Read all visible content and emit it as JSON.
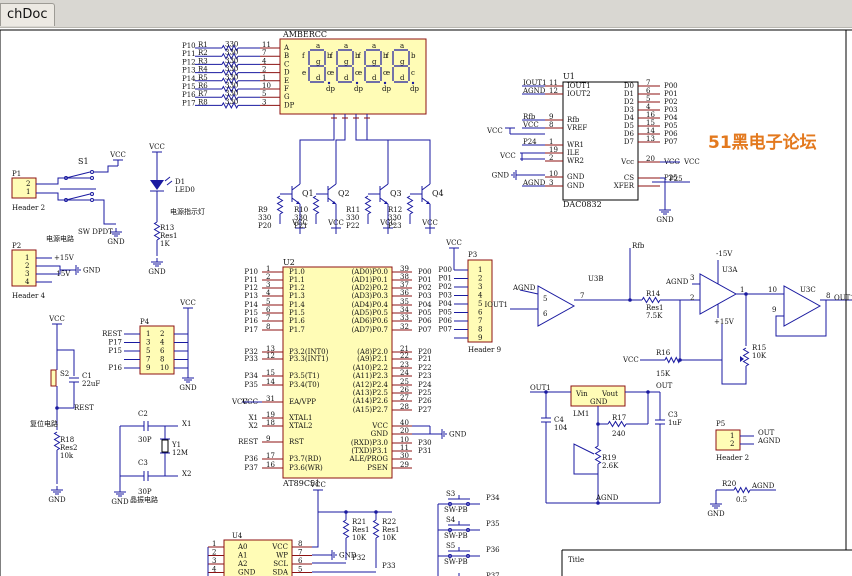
{
  "tab": {
    "label": "chDoc"
  },
  "forum": "51黑电子论坛",
  "display": {
    "ref": "AMBERCC",
    "segments": [
      "A",
      "B",
      "C",
      "D",
      "E",
      "F",
      "G",
      "DP"
    ],
    "seg_pins": [
      "11",
      "7",
      "4",
      "2",
      "1",
      "10",
      "5",
      "3"
    ],
    "nets": [
      "P10",
      "P11",
      "P12",
      "P13",
      "P14",
      "P15",
      "P16",
      "P17"
    ],
    "resistors": [
      "R1",
      "R2",
      "R3",
      "R4",
      "R5",
      "R6",
      "R7",
      "R8"
    ],
    "res_value": "330",
    "digit_labels": [
      "a",
      "b",
      "c",
      "d",
      "e",
      "f",
      "g",
      "dp"
    ]
  },
  "transistors": [
    {
      "ref": "Q1",
      "res": "R9",
      "res_val": "330",
      "net": "P20",
      "vcc": "VCC"
    },
    {
      "ref": "Q2",
      "res": "R10",
      "res_val": "330",
      "net": "P21",
      "vcc": "VCC"
    },
    {
      "ref": "Q3",
      "res": "R11",
      "res_val": "330",
      "net": "P22",
      "vcc": "VCC"
    },
    {
      "ref": "Q4",
      "res": "R12",
      "res_val": "330",
      "net": "P23",
      "vcc": "VCC"
    }
  ],
  "dac": {
    "ref": "U1",
    "part": "DAC0832",
    "left_pins": [
      [
        "IOUT1",
        "11",
        "IOUT1"
      ],
      [
        "AGND",
        "12",
        "IOUT2"
      ],
      [
        "Rfb",
        "9",
        "Rfb"
      ],
      [
        "VCC",
        "8",
        "VREF"
      ],
      [
        "P24",
        "1",
        "WR1"
      ],
      [
        "",
        "19",
        "ILE"
      ],
      [
        "",
        "2",
        "WR2"
      ],
      [
        "",
        "10",
        "GND"
      ],
      [
        "AGND",
        "3",
        "GND"
      ]
    ],
    "right_pins": [
      [
        "D0",
        "7",
        "P00"
      ],
      [
        "D1",
        "6",
        "P01"
      ],
      [
        "D2",
        "5",
        "P02"
      ],
      [
        "D3",
        "4",
        "P03"
      ],
      [
        "D4",
        "16",
        "P04"
      ],
      [
        "D5",
        "15",
        "P05"
      ],
      [
        "D6",
        "14",
        "P06"
      ],
      [
        "D7",
        "13",
        "P07"
      ],
      [
        "Vcc",
        "20",
        "VCC"
      ],
      [
        "CS",
        "",
        "P25"
      ],
      [
        "XFER",
        "",
        ""
      ]
    ],
    "gnd": "GND",
    "vcc": "VCC"
  },
  "header2": {
    "ref": "P1",
    "pins": [
      "2",
      "1"
    ],
    "name": "Header 2"
  },
  "switch": {
    "ref": "S1",
    "name": "SW DPDT",
    "label": "电源电路",
    "vcc": "VCC",
    "gnd": "GND"
  },
  "led": {
    "ref": "D1",
    "name": "LED0",
    "label": "电源指示灯",
    "res": "R13",
    "res_val": "Res1",
    "res_val2": "1K",
    "vcc": "VCC",
    "gnd": "GND"
  },
  "header4": {
    "ref": "P2",
    "pins": [
      "1",
      "2",
      "3",
      "4"
    ],
    "name": "Header 4",
    "nets": [
      "+15V",
      "",
      "-15V",
      ""
    ],
    "gnd": "GND"
  },
  "reset_circuit": {
    "sw": "S2",
    "cap": "C1",
    "cap_val": "22uF",
    "res": "R18",
    "res_val": "Res2",
    "res_val2": "10k",
    "net": "REST",
    "label": "复位电路",
    "vcc": "VCC",
    "gnd": "GND"
  },
  "p4": {
    "ref": "P4",
    "nets": [
      "REST",
      "P17",
      "P15",
      "",
      "P16"
    ],
    "pins": [
      [
        "1",
        "2"
      ],
      [
        "3",
        "4"
      ],
      [
        "5",
        "6"
      ],
      [
        "7",
        "8"
      ],
      [
        "9",
        "10"
      ]
    ],
    "vcc": "VCC",
    "gnd": "GND"
  },
  "crystal": {
    "c2": "C2",
    "c2v": "30P",
    "c3": "C3",
    "c3v": "30P",
    "y": "Y1",
    "yv": "12M",
    "x1": "X1",
    "x2": "X2",
    "label": "晶振电路",
    "gnd": "GND"
  },
  "mcu": {
    "ref": "U2",
    "part": "AT89C51",
    "left": [
      [
        "P10",
        "1",
        "P1.0"
      ],
      [
        "P11",
        "2",
        "P1.1"
      ],
      [
        "P12",
        "3",
        "P1.2"
      ],
      [
        "P13",
        "4",
        "P1.3"
      ],
      [
        "P14",
        "5",
        "P1.4"
      ],
      [
        "P15",
        "6",
        "P1.5"
      ],
      [
        "P16",
        "7",
        "P1.6"
      ],
      [
        "P17",
        "8",
        "P1.7"
      ],
      [
        "P32",
        "13",
        "P3.2(INT0)"
      ],
      [
        "P33",
        "12",
        "P3.3(INT1)"
      ],
      [
        "P34",
        "15",
        "P3.5(T1)"
      ],
      [
        "P35",
        "14",
        "P3.4(T0)"
      ],
      [
        "VCC",
        "31",
        "EA/VPP"
      ],
      [
        "X1",
        "19",
        "XTAL1"
      ],
      [
        "X2",
        "18",
        "XTAL2"
      ],
      [
        "REST",
        "9",
        "RST"
      ],
      [
        "P36",
        "17",
        "P3.7(RD)"
      ],
      [
        "P37",
        "16",
        "P3.6(WR)"
      ]
    ],
    "right": [
      [
        "P00",
        "39",
        "(AD0)P0.0"
      ],
      [
        "P01",
        "38",
        "(AD1)P0.1"
      ],
      [
        "P02",
        "37",
        "(AD2)P0.2"
      ],
      [
        "P03",
        "36",
        "(AD3)P0.3"
      ],
      [
        "P04",
        "35",
        "(AD4)P0.4"
      ],
      [
        "P05",
        "34",
        "(AD5)P0.5"
      ],
      [
        "P06",
        "33",
        "(AD6)P0.6"
      ],
      [
        "P07",
        "32",
        "(AD7)P0.7"
      ],
      [
        "P20",
        "21",
        "(A8)P2.0"
      ],
      [
        "P21",
        "22",
        "(A9)P2.1"
      ],
      [
        "P22",
        "23",
        "(A10)P2.2"
      ],
      [
        "P23",
        "24",
        "(A11)P2.3"
      ],
      [
        "P24",
        "25",
        "(A12)P2.4"
      ],
      [
        "P25",
        "26",
        "(A13)P2.5"
      ],
      [
        "P26",
        "27",
        "(A14)P2.6"
      ],
      [
        "P27",
        "28",
        "(A15)P2.7"
      ],
      [
        "",
        "40",
        "VCC"
      ],
      [
        "GND",
        "20",
        "GND"
      ],
      [
        "P30",
        "10",
        "(RXD)P3.0"
      ],
      [
        "P31",
        "11",
        "(TXD)P3.1"
      ],
      [
        "",
        "30",
        "ALE/PROG"
      ],
      [
        "",
        "29",
        "PSEN"
      ]
    ]
  },
  "p3": {
    "ref": "P3",
    "nets": [
      "P00",
      "P01",
      "P02",
      "P03",
      "P04",
      "P05",
      "P06",
      "P07",
      ""
    ],
    "pins": [
      "1",
      "2",
      "3",
      "4",
      "5",
      "6",
      "7",
      "8",
      "9"
    ],
    "name": "Header 9",
    "vcc": "VCC"
  },
  "opamp": {
    "u3b": "U3B",
    "u3a": "U3A",
    "u3c": "U3C",
    "rfb": "Rfb",
    "iout": "IOUT1",
    "agnd": "AGND",
    "r14": "R14",
    "r14v": "Res1",
    "r14v2": "7.5K",
    "r16": "R16",
    "r16v": "15K",
    "r15": "R15",
    "r15v": "10K",
    "v_pos": "+15V",
    "v_neg": "-15V",
    "out": "OUT1",
    "vcc": "VCC"
  },
  "regulator": {
    "ref": "LM1",
    "vin": "Vin",
    "vout": "Vout",
    "gnd": "GND",
    "c4": "C4",
    "c4v": "104",
    "c3": "C3",
    "c3v": "1uF",
    "r17": "R17",
    "r17v": "240",
    "r19": "R19",
    "r19v": "2.6K",
    "out1": "OUT1",
    "out": "OUT",
    "agnd": "AGND"
  },
  "p5": {
    "ref": "P5",
    "pins": [
      "1",
      "2"
    ],
    "nets": [
      "OUT",
      "AGND"
    ],
    "name": "Header 2"
  },
  "r20": {
    "ref": "R20",
    "val": "0.5",
    "agnd": "AGND",
    "gnd": "GND"
  },
  "eeprom": {
    "ref": "U4",
    "left": [
      [
        "1",
        "A0"
      ],
      [
        "2",
        "A1"
      ],
      [
        "3",
        "A2"
      ],
      [
        "4",
        "GND"
      ]
    ],
    "right": [
      [
        "8",
        "VCC"
      ],
      [
        "7",
        "WP"
      ],
      [
        "6",
        "SCL"
      ],
      [
        "5",
        "SDA"
      ]
    ],
    "vcc": "VCC",
    "gnd": "GND"
  },
  "pullups": [
    {
      "ref": "R21",
      "v": "Res1",
      "v2": "10K",
      "net": "P32"
    },
    {
      "ref": "R22",
      "v": "Res1",
      "v2": "10K",
      "net": "P33"
    }
  ],
  "buttons": [
    {
      "ref": "S3",
      "name": "SW-PB",
      "net": "P34"
    },
    {
      "ref": "S4",
      "name": "SW-PB",
      "net": "P35"
    },
    {
      "ref": "S5",
      "name": "SW-PB",
      "net": "P36"
    },
    {
      "ref": "",
      "name": "SW-PB",
      "net": "P37"
    }
  ],
  "titleblock": {
    "title": "Title"
  }
}
